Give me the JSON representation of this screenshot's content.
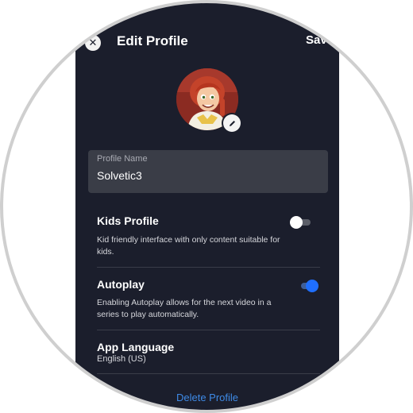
{
  "header": {
    "title": "Edit Profile",
    "save_label": "Sav",
    "close_icon": "close-icon",
    "status_glyph": "•"
  },
  "avatar": {
    "icon": "profile-avatar",
    "edit_icon": "pencil-icon"
  },
  "profile_name": {
    "label": "Profile Name",
    "value": "Solvetic3"
  },
  "settings": {
    "kids": {
      "title": "Kids Profile",
      "description": "Kid friendly interface with only content suitable for kids.",
      "enabled": false
    },
    "autoplay": {
      "title": "Autoplay",
      "description": "Enabling Autoplay allows for the next video in a series to play automatically.",
      "enabled": true
    },
    "language": {
      "title": "App Language",
      "value": "English (US)"
    }
  },
  "footer": {
    "delete_label": "Delete Profile"
  },
  "colors": {
    "background": "#1b1e2c",
    "field": "#3a3d47",
    "accent": "#1f6fff",
    "link": "#3e8ae6",
    "toggle_off_track": "#5b5e68",
    "toggle_off_knob": "#ffffff"
  }
}
